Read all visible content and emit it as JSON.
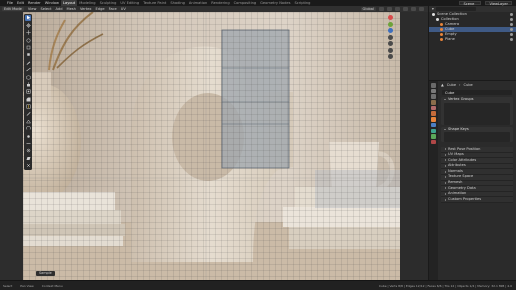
{
  "topbar": {
    "menus": [
      "File",
      "Edit",
      "Render",
      "Window",
      "Help"
    ],
    "workspaces": [
      "Layout",
      "Modeling",
      "Sculpting",
      "UV Editing",
      "Texture Paint",
      "Shading",
      "Animation",
      "Rendering",
      "Compositing",
      "Geometry Nodes",
      "Scripting"
    ],
    "active_workspace": "Layout",
    "scene": "Scene",
    "view_layer": "ViewLayer"
  },
  "viewport_header": {
    "mode": "Edit Mode",
    "menus": [
      "View",
      "Select",
      "Add",
      "Mesh",
      "Vertex",
      "Edge",
      "Face",
      "UV"
    ],
    "orientation": "Global"
  },
  "toolbar": {
    "tools": [
      "select-box",
      "cursor",
      "move",
      "rotate",
      "scale",
      "transform",
      "annotate",
      "measure",
      "add-cube",
      "extrude",
      "inset",
      "bevel",
      "loop-cut",
      "knife",
      "poly-build",
      "spin",
      "smooth",
      "edge-slide",
      "shrink-fatten",
      "shear",
      "rip"
    ]
  },
  "viewport_label": "Sample",
  "outliner": {
    "rows": [
      {
        "label": "Scene Collection",
        "indent": 0,
        "color": "#e0e0e0",
        "selected": false
      },
      {
        "label": "Collection",
        "indent": 1,
        "color": "#e0e0e0",
        "selected": false
      },
      {
        "label": "Camera",
        "indent": 2,
        "color": "#e8843a",
        "selected": false
      },
      {
        "label": "Cube",
        "indent": 2,
        "color": "#e8843a",
        "selected": true
      },
      {
        "label": "Empty",
        "indent": 2,
        "color": "#e8843a",
        "selected": false
      },
      {
        "label": "Plane",
        "indent": 2,
        "color": "#e8843a",
        "selected": false
      }
    ]
  },
  "properties": {
    "breadcrumb": [
      "Cube",
      "Cube"
    ],
    "name": "Cube",
    "panels": [
      {
        "label": "Vertex Groups",
        "expanded": true
      },
      {
        "label": "Shape Keys",
        "expanded": true
      }
    ],
    "collapsed": [
      "Rest Pose Position",
      "UV Maps",
      "Color Attributes",
      "Attributes",
      "Normals",
      "Texture Space",
      "Remesh",
      "Geometry Data",
      "Animation",
      "Custom Properties"
    ]
  },
  "statusbar": {
    "keys": [
      "Select",
      "Pan View",
      "Context Menu"
    ],
    "stats": "Cube | Verts 8/8 | Edges 12/12 | Faces 6/6 | Tris 12 | Objects 1/4 | Memory: 32.1 MiB | 4.0"
  },
  "colors": {
    "accent_blue": "#4772b3",
    "object_orange": "#e8843a",
    "selection_row": "#3f5a85",
    "axis_x": "#d94a4a",
    "axis_y": "#6da23a",
    "axis_z": "#3e6fbe"
  }
}
